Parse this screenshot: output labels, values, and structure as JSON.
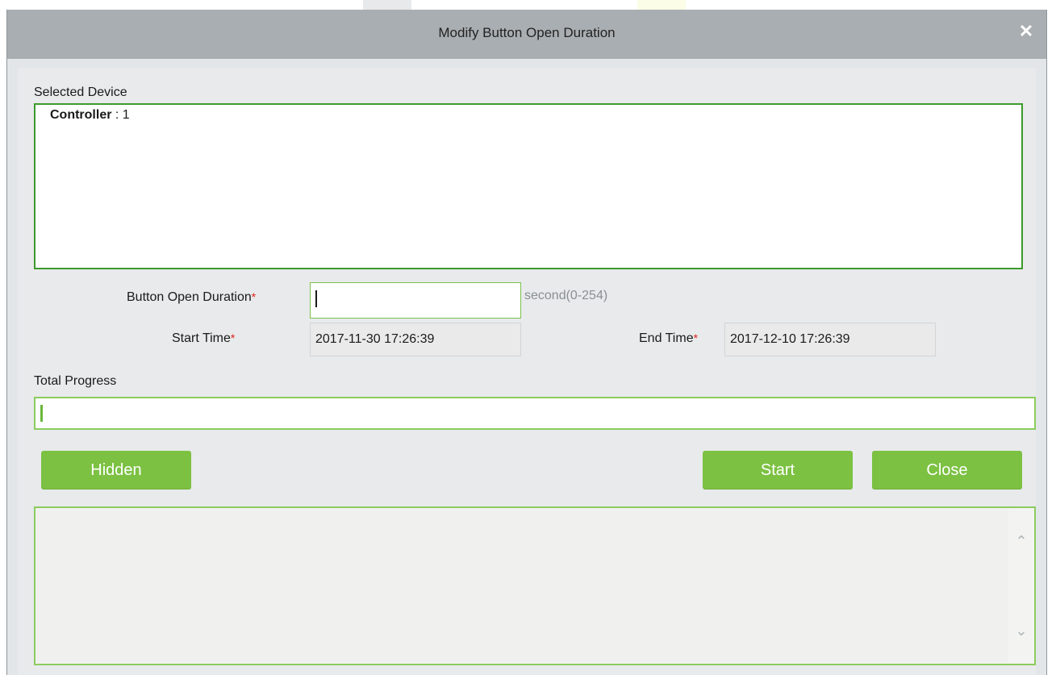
{
  "dialog": {
    "title": "Modify Button Open Duration",
    "close_icon": "close-icon"
  },
  "selected_device": {
    "label": "Selected Device",
    "device_name": "Controller",
    "device_separator": " : ",
    "device_value": "1"
  },
  "form": {
    "button_open_duration": {
      "label": "Button Open Duration",
      "value": "",
      "hint": "second(0-254)"
    },
    "start_time": {
      "label": "Start Time",
      "value": "2017-11-30 17:26:39"
    },
    "end_time": {
      "label": "End Time",
      "value": "2017-12-10 17:26:39"
    },
    "required_mark": "*"
  },
  "progress": {
    "label": "Total Progress",
    "value_percent": 0
  },
  "buttons": {
    "hidden": "Hidden",
    "start": "Start",
    "close": "Close"
  },
  "log": {
    "scroll_up_icon": "chevron-up-icon",
    "scroll_down_icon": "chevron-down-icon"
  },
  "colors": {
    "accent": "#7cc142",
    "border_green": "#3c9a2c",
    "required": "#e0201b",
    "titlebar": "#a9aeb2"
  }
}
